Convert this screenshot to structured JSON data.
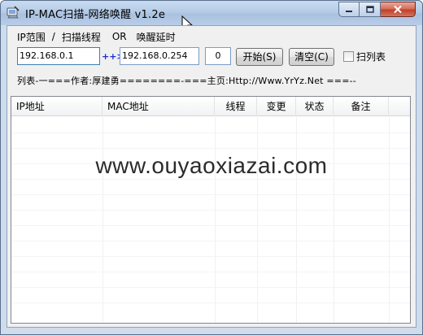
{
  "window": {
    "title": "IP-MAC扫描-网络唤醒 v1.2e"
  },
  "toolbar": {
    "range_label": "IP范围",
    "sep1": "/",
    "scan_threads_label": "扫描线程",
    "or_label": "OR",
    "wake_delay_label": "唤醒延时"
  },
  "inputs": {
    "start_ip": "192.168.0.1",
    "arrow": "++>",
    "end_ip": "192.168.0.254",
    "threads": "0"
  },
  "buttons": {
    "start": "开始(S)",
    "clear": "清空(C)"
  },
  "checkbox": {
    "label": "扫列表",
    "checked": false
  },
  "info_line": "列表-一===作者:厚建勇========-===主页:Http://Www.YrYz.Net ===--",
  "list": {
    "columns": [
      "IP地址",
      "MAC地址",
      "线程",
      "变更",
      "状态",
      "备注"
    ]
  },
  "watermark": "www.ouyaoxiazai.com"
}
